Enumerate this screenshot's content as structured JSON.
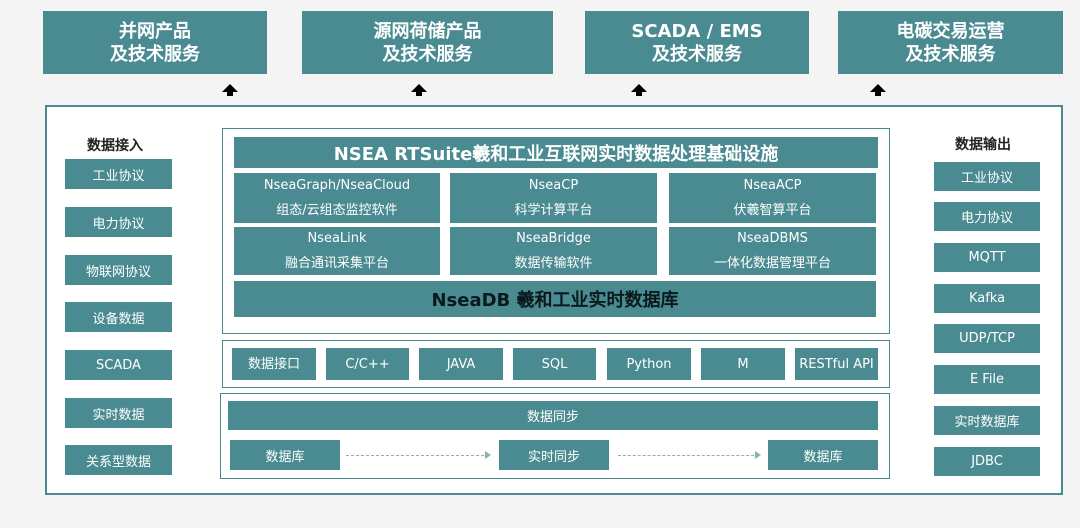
{
  "top_products": [
    {
      "line1": "并网产品",
      "line2": "及技术服务"
    },
    {
      "line1": "源网荷储产品",
      "line2": "及技术服务"
    },
    {
      "line1": "SCADA / EMS",
      "line2": "及技术服务"
    },
    {
      "line1": "电碳交易运营",
      "line2": "及技术服务"
    }
  ],
  "data_input": {
    "title": "数据接入",
    "items": [
      "工业协议",
      "电力协议",
      "物联网协议",
      "设备数据",
      "SCADA",
      "实时数据",
      "关系型数据"
    ]
  },
  "data_output": {
    "title": "数据输出",
    "items": [
      "工业协议",
      "电力协议",
      "MQTT",
      "Kafka",
      "UDP/TCP",
      "E File",
      "实时数据库",
      "JDBC"
    ]
  },
  "platform": {
    "title": "NSEA RTSuite羲和工业互联网实时数据处理基础设施",
    "modules": [
      {
        "name": "NseaGraph/NseaCloud",
        "desc": "组态/云组态监控软件"
      },
      {
        "name": "NseaCP",
        "desc": "科学计算平台"
      },
      {
        "name": "NseaACP",
        "desc": "伏羲智算平台"
      },
      {
        "name": "NseaLink",
        "desc": "融合通讯采集平台"
      },
      {
        "name": "NseaBridge",
        "desc": "数据传输软件"
      },
      {
        "name": "NseaDBMS",
        "desc": "一体化数据管理平台"
      }
    ],
    "db": "NseaDB 羲和工业实时数据库"
  },
  "interfaces": [
    "数据接口",
    "C/C++",
    "JAVA",
    "SQL",
    "Python",
    "M",
    "RESTful API"
  ],
  "sync": {
    "title": "数据同步",
    "left": "数据库",
    "middle": "实时同步",
    "right": "数据库"
  },
  "colors": {
    "teal": "#4a8b91",
    "border": "#4a8b91",
    "background": "#f4f4f4"
  }
}
